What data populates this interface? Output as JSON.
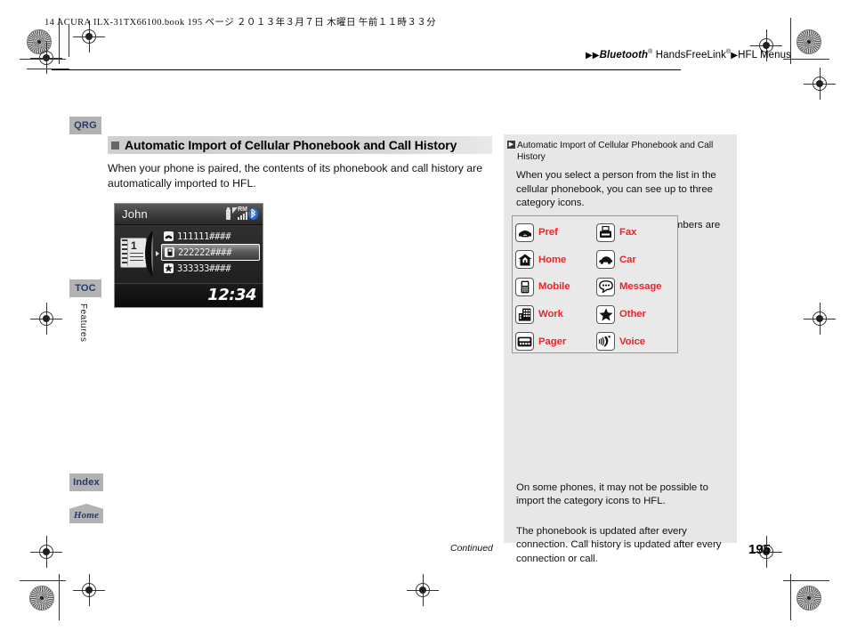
{
  "print_meta": {
    "file_line": "14 ACURA ILX-31TX66100.book   195 ページ   ２０１３年３月７日   木曜日   午前１１時３３分"
  },
  "breadcrumb": {
    "arrow1": "▶▶",
    "bluetooth": "Bluetooth",
    "reg1": "®",
    "handsfree": " HandsFreeLink",
    "reg2": "®",
    "arrow2": "▶",
    "hfl_menus": "HFL Menus"
  },
  "left_tabs": [
    {
      "id": "qrg",
      "label": "QRG"
    },
    {
      "id": "toc",
      "label": "TOC"
    },
    {
      "id": "index",
      "label": "Index"
    },
    {
      "id": "home",
      "label": "Home"
    }
  ],
  "vertical_tab_label": "Features",
  "main": {
    "heading": "Automatic Import of Cellular Phonebook and Call History",
    "body": "When your phone is paired, the contents of its phonebook and call history are automatically imported to HFL."
  },
  "device": {
    "contact_name": "John",
    "status_roaming": "RM",
    "status_bluetooth": "ʙ",
    "phonebook_index": "1",
    "rows": [
      {
        "icon": "☎",
        "number": "111111####",
        "selected": false
      },
      {
        "icon": "▐",
        "number": "222222####",
        "selected": true
      },
      {
        "icon": "★",
        "number": "333333####",
        "selected": false
      }
    ],
    "clock": "12:34"
  },
  "sidebar": {
    "ref_title": "Automatic Import of Cellular Phonebook and Call History",
    "para1": "When you select a person from the list in the cellular phonebook, you can see up to three category icons.",
    "para2": "The icons indicate what types of numbers are stored for that name.",
    "para3": "On some phones, it may not be possible to import the category icons to HFL.",
    "para4": "The phonebook is updated after every connection. Call history is updated after every connection or call.",
    "icon_table": [
      {
        "icon": "telephone-icon",
        "label": "Pref"
      },
      {
        "icon": "fax-icon",
        "label": "Fax"
      },
      {
        "icon": "home-icon",
        "label": "Home"
      },
      {
        "icon": "car-icon",
        "label": "Car"
      },
      {
        "icon": "mobile-phone-icon",
        "label": "Mobile"
      },
      {
        "icon": "message-bubble-icon",
        "label": "Message"
      },
      {
        "icon": "office-building-icon",
        "label": "Work"
      },
      {
        "icon": "star-icon",
        "label": "Other"
      },
      {
        "icon": "pager-icon",
        "label": "Pager"
      },
      {
        "icon": "voice-icon",
        "label": "Voice"
      }
    ]
  },
  "footer": {
    "continued": "Continued",
    "page_number": "195"
  },
  "colors": {
    "accent_red": "#e8252b",
    "tab_blue": "#253a6b",
    "tab_gray": "#b3b3b3",
    "sidebar_bg": "#e7e7e7"
  }
}
